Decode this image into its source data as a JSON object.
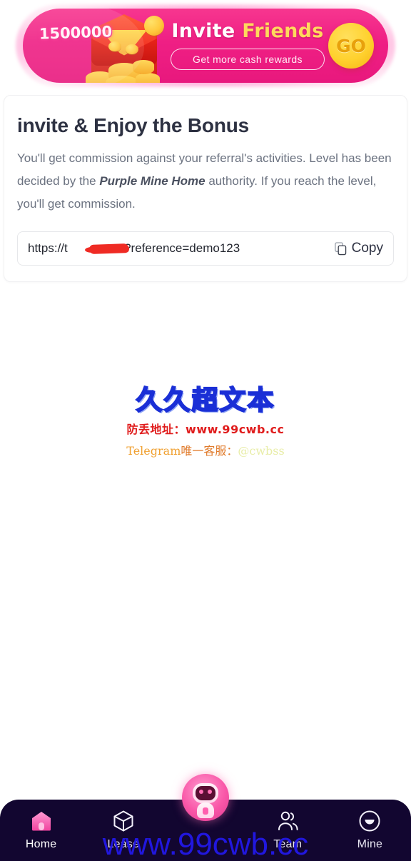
{
  "banner": {
    "amount": "1500000",
    "headline_white": "Invite",
    "headline_yellow": "Friends",
    "subtitle": "Get more cash rewards",
    "go_label": "GO"
  },
  "card": {
    "title": "invite & Enjoy the Bonus",
    "desc_part1": "You'll get commission against your referral's activities. Level has been decided by the ",
    "desc_emphasis": "Purple Mine Home",
    "desc_part2": " authority. If you reach the level, you'll get commission.",
    "referral_link": "https://t█████.com?reference=demo123",
    "referral_link_prefix": "https://t",
    "referral_link_suffix": ".com?reference=demo123",
    "copy_label": "Copy"
  },
  "watermark": {
    "title": "久久超文本",
    "address_label": "防丢地址：",
    "address_value": "www.99cwb.cc",
    "telegram_prefix": "Telegram",
    "telegram_label": "唯一客服：",
    "telegram_handle": "@cwbss",
    "bottom": "www.99cwb.cc"
  },
  "nav": {
    "items": [
      {
        "label": "Home",
        "icon": "home-icon",
        "active": true
      },
      {
        "label": "Lease",
        "icon": "cube-icon",
        "active": false
      },
      {
        "label": "Team",
        "icon": "people-icon",
        "active": false
      },
      {
        "label": "Mine",
        "icon": "profile-icon",
        "active": false
      }
    ],
    "fab_icon": "robot-mascot-icon"
  },
  "colors": {
    "banner_pink": "#ef1f84",
    "gold": "#ffd12e",
    "nav_bg": "#120630",
    "accent_pink": "#f957a8",
    "watermark_blue": "#2218e8",
    "watermark_red": "#e01c1c"
  }
}
